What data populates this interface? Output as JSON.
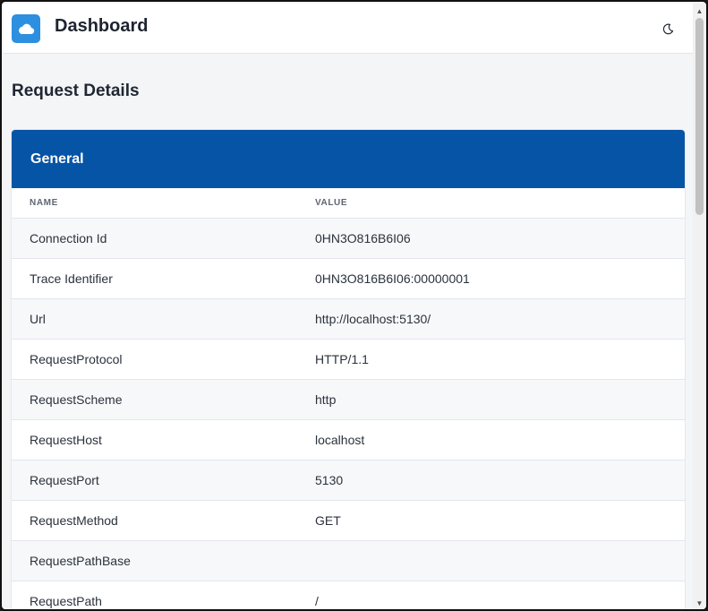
{
  "header": {
    "app_title": "Dashboard",
    "logo_icon": "cloud-icon",
    "theme_icon": "moon-icon"
  },
  "page": {
    "title": "Request Details"
  },
  "card": {
    "title": "General",
    "columns": {
      "name": "NAME",
      "value": "VALUE"
    },
    "rows": [
      {
        "name": "Connection Id",
        "value": "0HN3O816B6I06"
      },
      {
        "name": "Trace Identifier",
        "value": "0HN3O816B6I06:00000001"
      },
      {
        "name": "Url",
        "value": "http://localhost:5130/"
      },
      {
        "name": "RequestProtocol",
        "value": "HTTP/1.1"
      },
      {
        "name": "RequestScheme",
        "value": "http"
      },
      {
        "name": "RequestHost",
        "value": "localhost"
      },
      {
        "name": "RequestPort",
        "value": "5130"
      },
      {
        "name": "RequestMethod",
        "value": "GET"
      },
      {
        "name": "RequestPathBase",
        "value": ""
      },
      {
        "name": "RequestPath",
        "value": "/"
      }
    ]
  },
  "colors": {
    "card_header": "#0654a6",
    "logo_bg": "#2d8fe0"
  }
}
